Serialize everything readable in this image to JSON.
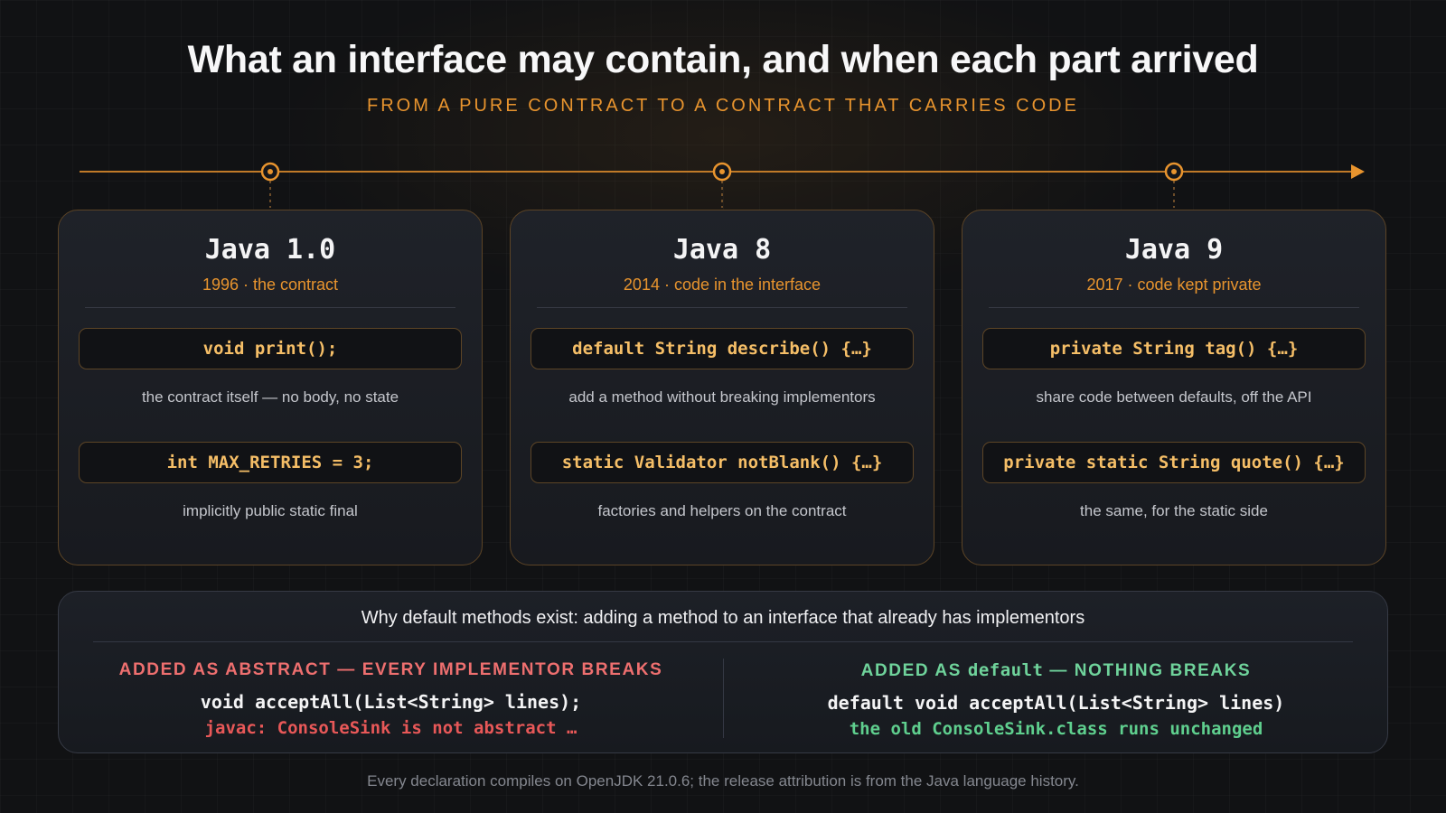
{
  "header": {
    "title": "What an interface may contain, and when each part arrived",
    "subtitle": "FROM A PURE CONTRACT TO A CONTRACT THAT CARRIES CODE"
  },
  "cards": [
    {
      "version": "Java 1.0",
      "subtitle": "1996 · the contract",
      "items": [
        {
          "code": "void print();",
          "note": "the contract itself — no body, no state"
        },
        {
          "code": "int MAX_RETRIES = 3;",
          "note": "implicitly public static final"
        }
      ]
    },
    {
      "version": "Java 8",
      "subtitle": "2014 · code in the interface",
      "items": [
        {
          "code": "default String describe() {…}",
          "note": "add a method without breaking implementors"
        },
        {
          "code": "static Validator notBlank() {…}",
          "note": "factories and helpers on the contract"
        }
      ]
    },
    {
      "version": "Java 9",
      "subtitle": "2017 · code kept private",
      "items": [
        {
          "code": "private String tag() {…}",
          "note": "share code between defaults, off the API"
        },
        {
          "code": "private static String quote() {…}",
          "note": "the same, for the static side"
        }
      ]
    }
  ],
  "comparison": {
    "title": "Why default methods exist: adding a method to an interface that already has implementors",
    "left": {
      "heading": "ADDED AS ABSTRACT — EVERY IMPLEMENTOR BREAKS",
      "code": "void acceptAll(List<String> lines);",
      "result": "javac: ConsoleSink is not abstract …"
    },
    "right": {
      "heading_prefix": "ADDED AS ",
      "heading_keyword": "default",
      "heading_suffix": " — NOTHING BREAKS",
      "code": "default void acceptAll(List<String> lines)",
      "result": "the old ConsoleSink.class runs unchanged"
    }
  },
  "footnote": "Every declaration compiles on OpenJDK 21.0.6; the release attribution is from the Java language history.",
  "colors": {
    "accent": "#e8942e",
    "code": "#f5be67",
    "error": "#ee6f6f",
    "success": "#6fd39b"
  }
}
